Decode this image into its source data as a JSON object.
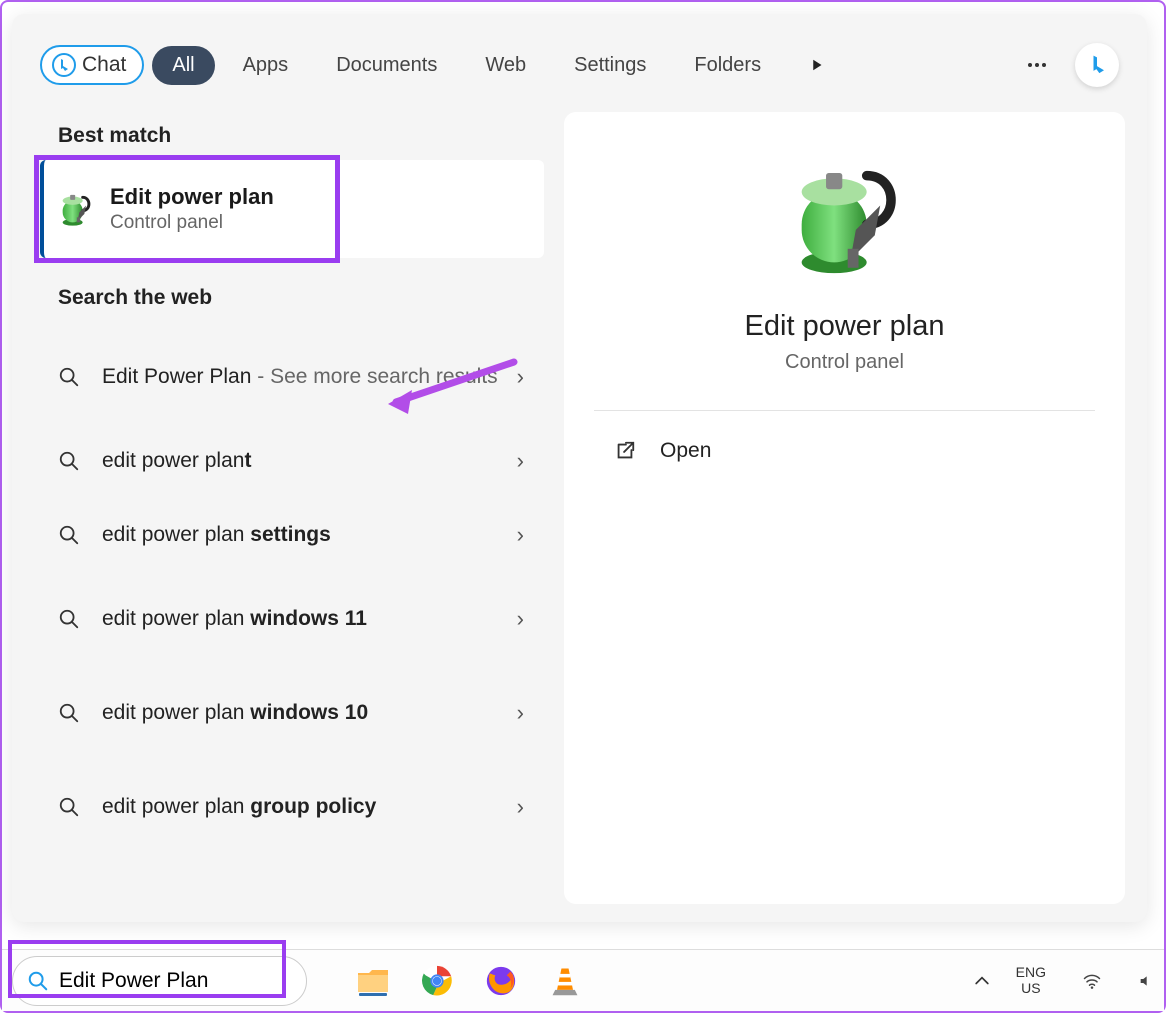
{
  "filters": {
    "chat": "Chat",
    "all": "All",
    "apps": "Apps",
    "documents": "Documents",
    "web": "Web",
    "settings": "Settings",
    "folders": "Folders"
  },
  "sections": {
    "best_match": "Best match",
    "search_web": "Search the web"
  },
  "best_match": {
    "title": "Edit power plan",
    "subtitle": "Control panel"
  },
  "web_results": [
    {
      "prefix": "Edit Power Plan",
      "suffix": "",
      "gray": " - See more search results"
    },
    {
      "prefix": "edit power plan",
      "suffix": "t",
      "gray": ""
    },
    {
      "prefix": "edit power plan ",
      "suffix": "settings",
      "gray": ""
    },
    {
      "prefix": "edit power plan ",
      "suffix": "windows 11",
      "gray": ""
    },
    {
      "prefix": "edit power plan ",
      "suffix": "windows 10",
      "gray": ""
    },
    {
      "prefix": "edit power plan ",
      "suffix": "group policy",
      "gray": ""
    }
  ],
  "detail": {
    "title": "Edit power plan",
    "subtitle": "Control panel",
    "open_label": "Open"
  },
  "taskbar": {
    "search_value": "Edit Power Plan",
    "lang_line1": "ENG",
    "lang_line2": "US"
  }
}
